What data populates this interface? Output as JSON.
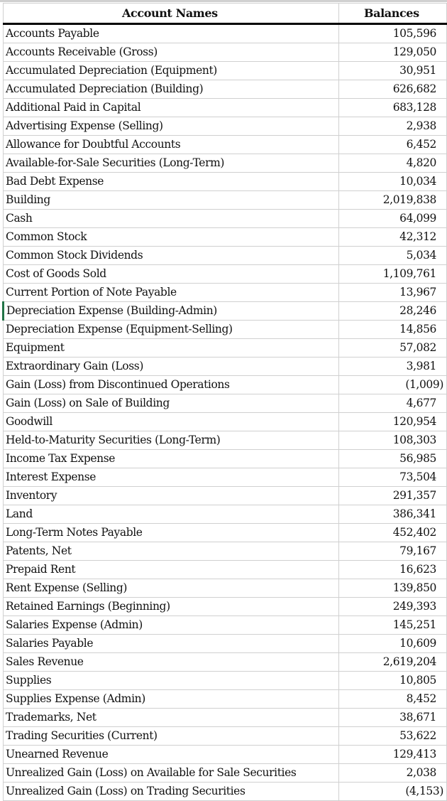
{
  "table": {
    "headers": {
      "name": "Account Names",
      "balance": "Balances"
    },
    "rows": [
      {
        "name": "Accounts Payable",
        "balance": "105,596"
      },
      {
        "name": "Accounts Receivable (Gross)",
        "balance": "129,050"
      },
      {
        "name": "Accumulated Depreciation (Equipment)",
        "balance": "30,951"
      },
      {
        "name": "Accumulated Depreciation (Building)",
        "balance": "626,682"
      },
      {
        "name": "Additional Paid in Capital",
        "balance": "683,128"
      },
      {
        "name": "Advertising Expense (Selling)",
        "balance": "2,938"
      },
      {
        "name": "Allowance for Doubtful Accounts",
        "balance": "6,452"
      },
      {
        "name": "Available-for-Sale Securities (Long-Term)",
        "balance": "4,820"
      },
      {
        "name": "Bad Debt Expense",
        "balance": "10,034"
      },
      {
        "name": "Building",
        "balance": "2,019,838"
      },
      {
        "name": "Cash",
        "balance": "64,099"
      },
      {
        "name": "Common Stock",
        "balance": "42,312"
      },
      {
        "name": "Common Stock Dividends",
        "balance": "5,034"
      },
      {
        "name": "Cost of Goods Sold",
        "balance": "1,109,761"
      },
      {
        "name": "Current Portion of Note Payable",
        "balance": "13,967"
      },
      {
        "name": "Depreciation Expense (Building-Admin)",
        "balance": "28,246"
      },
      {
        "name": "Depreciation Expense (Equipment-Selling)",
        "balance": "14,856"
      },
      {
        "name": "Equipment",
        "balance": "57,082"
      },
      {
        "name": "Extraordinary Gain (Loss)",
        "balance": "3,981"
      },
      {
        "name": "Gain (Loss) from Discontinued Operations",
        "balance": "(1,009)"
      },
      {
        "name": "Gain (Loss) on Sale of Building",
        "balance": "4,677"
      },
      {
        "name": "Goodwill",
        "balance": "120,954"
      },
      {
        "name": "Held-to-Maturity Securities (Long-Term)",
        "balance": "108,303"
      },
      {
        "name": "Income Tax Expense",
        "balance": "56,985"
      },
      {
        "name": "Interest Expense",
        "balance": "73,504"
      },
      {
        "name": "Inventory",
        "balance": "291,357"
      },
      {
        "name": "Land",
        "balance": "386,341"
      },
      {
        "name": "Long-Term Notes Payable",
        "balance": "452,402"
      },
      {
        "name": "Patents, Net",
        "balance": "79,167"
      },
      {
        "name": "Prepaid Rent",
        "balance": "16,623"
      },
      {
        "name": "Rent Expense (Selling)",
        "balance": "139,850"
      },
      {
        "name": "Retained Earnings (Beginning)",
        "balance": "249,393"
      },
      {
        "name": "Salaries Expense (Admin)",
        "balance": "145,251"
      },
      {
        "name": "Salaries Payable",
        "balance": "10,609"
      },
      {
        "name": "Sales Revenue",
        "balance": "2,619,204"
      },
      {
        "name": "Supplies",
        "balance": "10,805"
      },
      {
        "name": "Supplies Expense (Admin)",
        "balance": "8,452"
      },
      {
        "name": "Trademarks, Net",
        "balance": "38,671"
      },
      {
        "name": "Trading Securities (Current)",
        "balance": "53,622"
      },
      {
        "name": "Unearned Revenue",
        "balance": "129,413"
      },
      {
        "name": "Unrealized Gain (Loss) on Available for Sale Securities",
        "balance": "2,038"
      },
      {
        "name": "Unrealized Gain (Loss) on Trading Securities",
        "balance": "(4,153)"
      }
    ],
    "selected_row_index": 15,
    "selection_color": "#217346"
  }
}
